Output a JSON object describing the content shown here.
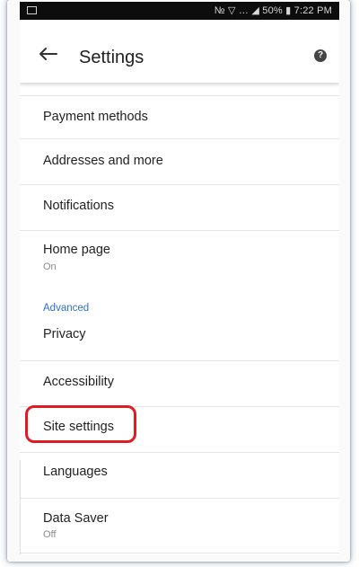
{
  "status_bar": {
    "right_text": "№ ▽ … ◢ 50% ▮ 7:22 PM"
  },
  "app_bar": {
    "title": "Settings",
    "back_icon": "arrow-back-icon",
    "help_icon": "help-icon"
  },
  "settings": {
    "items": [
      {
        "label": "Payment methods"
      },
      {
        "label": "Addresses and more"
      },
      {
        "label": "Notifications"
      },
      {
        "label": "Home page",
        "sub": "On"
      },
      {
        "label": "Privacy"
      },
      {
        "label": "Accessibility"
      },
      {
        "label": "Site settings"
      },
      {
        "label": "Languages"
      },
      {
        "label": "Data Saver",
        "sub": "Off"
      }
    ],
    "section_advanced": "Advanced"
  },
  "colors": {
    "accent": "#2f6fd1",
    "highlight": "#e01b24"
  }
}
